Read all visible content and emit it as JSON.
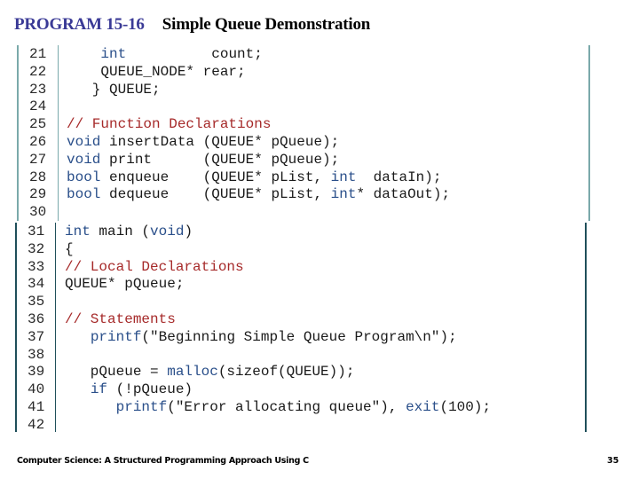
{
  "header": {
    "program_label": "PROGRAM 15-16",
    "program_title": "Simple Queue Demonstration"
  },
  "code_top": [
    {
      "num": "21",
      "tokens": [
        {
          "t": "    ",
          "c": ""
        },
        {
          "t": "int",
          "c": "kw"
        },
        {
          "t": "          count;",
          "c": ""
        }
      ]
    },
    {
      "num": "22",
      "tokens": [
        {
          "t": "    QUEUE_NODE* rear;",
          "c": ""
        }
      ]
    },
    {
      "num": "23",
      "tokens": [
        {
          "t": "   } QUEUE;",
          "c": ""
        }
      ]
    },
    {
      "num": "24",
      "tokens": [
        {
          "t": "",
          "c": ""
        }
      ]
    },
    {
      "num": "25",
      "tokens": [
        {
          "t": "// Function Declarations",
          "c": "cm"
        }
      ]
    },
    {
      "num": "26",
      "tokens": [
        {
          "t": "void",
          "c": "kw"
        },
        {
          "t": " insertData (QUEUE* pQueue);",
          "c": ""
        }
      ]
    },
    {
      "num": "27",
      "tokens": [
        {
          "t": "void",
          "c": "kw"
        },
        {
          "t": " print      (QUEUE* pQueue);",
          "c": ""
        }
      ]
    },
    {
      "num": "28",
      "tokens": [
        {
          "t": "bool",
          "c": "kw"
        },
        {
          "t": " enqueue    (QUEUE* pList, ",
          "c": ""
        },
        {
          "t": "int",
          "c": "kw"
        },
        {
          "t": "  dataIn);",
          "c": ""
        }
      ]
    },
    {
      "num": "29",
      "tokens": [
        {
          "t": "bool",
          "c": "kw"
        },
        {
          "t": " dequeue    (QUEUE* pList, ",
          "c": ""
        },
        {
          "t": "int",
          "c": "kw"
        },
        {
          "t": "* dataOut);",
          "c": ""
        }
      ]
    },
    {
      "num": "30",
      "tokens": [
        {
          "t": "",
          "c": ""
        }
      ]
    }
  ],
  "code_bottom": [
    {
      "num": "31",
      "tokens": [
        {
          "t": "int",
          "c": "kw"
        },
        {
          "t": " main (",
          "c": ""
        },
        {
          "t": "void",
          "c": "kw"
        },
        {
          "t": ")",
          "c": ""
        }
      ]
    },
    {
      "num": "32",
      "tokens": [
        {
          "t": "{",
          "c": ""
        }
      ]
    },
    {
      "num": "33",
      "tokens": [
        {
          "t": "// Local Declarations",
          "c": "cm"
        }
      ]
    },
    {
      "num": "34",
      "tokens": [
        {
          "t": "QUEUE* pQueue;",
          "c": ""
        }
      ]
    },
    {
      "num": "35",
      "tokens": [
        {
          "t": "",
          "c": ""
        }
      ]
    },
    {
      "num": "36",
      "tokens": [
        {
          "t": "// Statements",
          "c": "cm"
        }
      ]
    },
    {
      "num": "37",
      "tokens": [
        {
          "t": "   ",
          "c": ""
        },
        {
          "t": "printf",
          "c": "fn"
        },
        {
          "t": "(\"Beginning Simple Queue Program\\n\");",
          "c": ""
        }
      ]
    },
    {
      "num": "38",
      "tokens": [
        {
          "t": "",
          "c": ""
        }
      ]
    },
    {
      "num": "39",
      "tokens": [
        {
          "t": "   pQueue = ",
          "c": ""
        },
        {
          "t": "malloc",
          "c": "fn"
        },
        {
          "t": "(sizeof(QUEUE));",
          "c": ""
        }
      ]
    },
    {
      "num": "40",
      "tokens": [
        {
          "t": "   ",
          "c": ""
        },
        {
          "t": "if",
          "c": "kw"
        },
        {
          "t": " (!pQueue)",
          "c": ""
        }
      ]
    },
    {
      "num": "41",
      "tokens": [
        {
          "t": "      ",
          "c": ""
        },
        {
          "t": "printf",
          "c": "fn"
        },
        {
          "t": "(\"Error allocating queue\"), ",
          "c": ""
        },
        {
          "t": "exit",
          "c": "fn"
        },
        {
          "t": "(100);",
          "c": ""
        }
      ]
    },
    {
      "num": "42",
      "tokens": [
        {
          "t": "",
          "c": ""
        }
      ]
    }
  ],
  "footer": {
    "book_title": "Computer Science: A Structured Programming Approach Using C",
    "page_number": "35"
  },
  "colors": {
    "program_label": "#3a3a96",
    "keyword": "#2a4f8a",
    "comment": "#a62a2a",
    "top_border": "#7aa9aa",
    "bottom_border": "#1f4f5a"
  }
}
